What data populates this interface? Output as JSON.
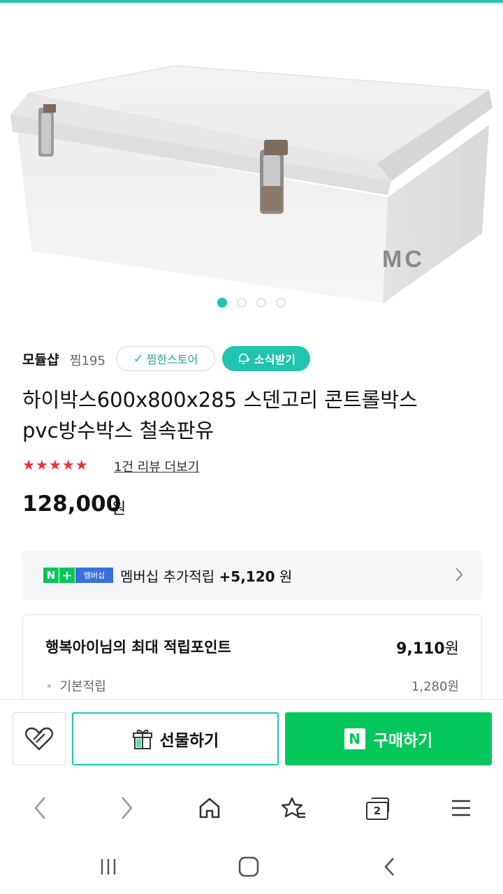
{
  "colors": {
    "accent": "#21c4ad",
    "naver_green": "#03c75a",
    "star_red": "#f0303a"
  },
  "image": {
    "watermark": "MC",
    "carousel_count": 4,
    "active_index": 0
  },
  "store": {
    "name": "모듈샵",
    "fav_count": "찜195",
    "fav_store_label": "찜한스토어",
    "news_label": "소식받기"
  },
  "product": {
    "title_line1": "하이박스600x800x285 스덴고리 콘트롤박스",
    "title_line2": "pvc방수박스 철속판유",
    "stars": "★★★★★",
    "rating": 5,
    "review_link": "1건 리뷰 더보기",
    "price": "128,000",
    "price_unit": "원"
  },
  "membership": {
    "badge_n": "N",
    "badge_plus": "+",
    "badge_label": "멤버십",
    "text": "멤버십 추가적립",
    "amount": "+5,120",
    "unit": "원"
  },
  "points": {
    "title": "행복아이님의 최대 적립포인트",
    "max_value": "9,110",
    "max_unit": "원",
    "basic_label": "기본적립",
    "basic_value": "1,280원"
  },
  "actions": {
    "gift_label": "선물하기",
    "buy_logo": "N",
    "buy_label": "구매하기"
  },
  "browser_nav": {
    "tab_count": "2",
    "icons": [
      "back-icon",
      "forward-icon",
      "home-icon",
      "bookmark-star-icon",
      "tabs-icon",
      "menu-icon"
    ]
  },
  "system_nav": {
    "icons": [
      "recent-apps-icon",
      "home-button-icon",
      "system-back-icon"
    ]
  }
}
